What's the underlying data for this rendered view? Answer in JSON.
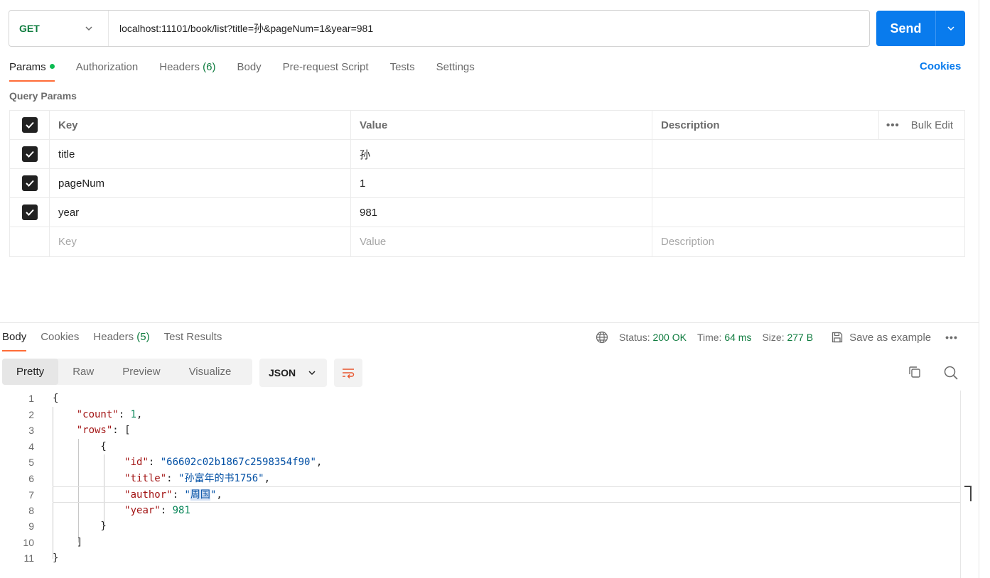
{
  "request": {
    "method": "GET",
    "url": "localhost:11101/book/list?title=孙&pageNum=1&year=981",
    "send_label": "Send"
  },
  "request_tabs": {
    "params": "Params",
    "authorization": "Authorization",
    "headers": "Headers",
    "headers_count": "(6)",
    "body": "Body",
    "pre_request": "Pre-request Script",
    "tests": "Tests",
    "settings": "Settings",
    "cookies": "Cookies"
  },
  "query_params": {
    "title": "Query Params",
    "columns": {
      "key": "Key",
      "value": "Value",
      "description": "Description",
      "bulk_edit": "Bulk Edit"
    },
    "rows": [
      {
        "key": "title",
        "value": "孙",
        "description": "",
        "checked": true
      },
      {
        "key": "pageNum",
        "value": "1",
        "description": "",
        "checked": true
      },
      {
        "key": "year",
        "value": "981",
        "description": "",
        "checked": true
      }
    ],
    "placeholder": {
      "key": "Key",
      "value": "Value",
      "description": "Description"
    }
  },
  "response_tabs": {
    "body": "Body",
    "cookies": "Cookies",
    "headers": "Headers",
    "headers_count": "(5)",
    "test_results": "Test Results"
  },
  "response_status": {
    "status_label": "Status:",
    "status_value": "200 OK",
    "time_label": "Time:",
    "time_value": "64 ms",
    "size_label": "Size:",
    "size_value": "277 B",
    "save_example": "Save as example"
  },
  "view_modes": {
    "pretty": "Pretty",
    "raw": "Raw",
    "preview": "Preview",
    "visualize": "Visualize"
  },
  "format": "JSON",
  "code": {
    "line_numbers": [
      "1",
      "2",
      "3",
      "4",
      "5",
      "6",
      "7",
      "8",
      "9",
      "10",
      "11"
    ],
    "count_key": "\"count\"",
    "count_val": "1",
    "rows_key": "\"rows\"",
    "id_key": "\"id\"",
    "id_val": "\"66602c02b1867c2598354f90\"",
    "title_key": "\"title\"",
    "title_val": "\"孙富年的书1756\"",
    "author_key": "\"author\"",
    "author_val": "周国",
    "year_key": "\"year\"",
    "year_val": "981"
  }
}
